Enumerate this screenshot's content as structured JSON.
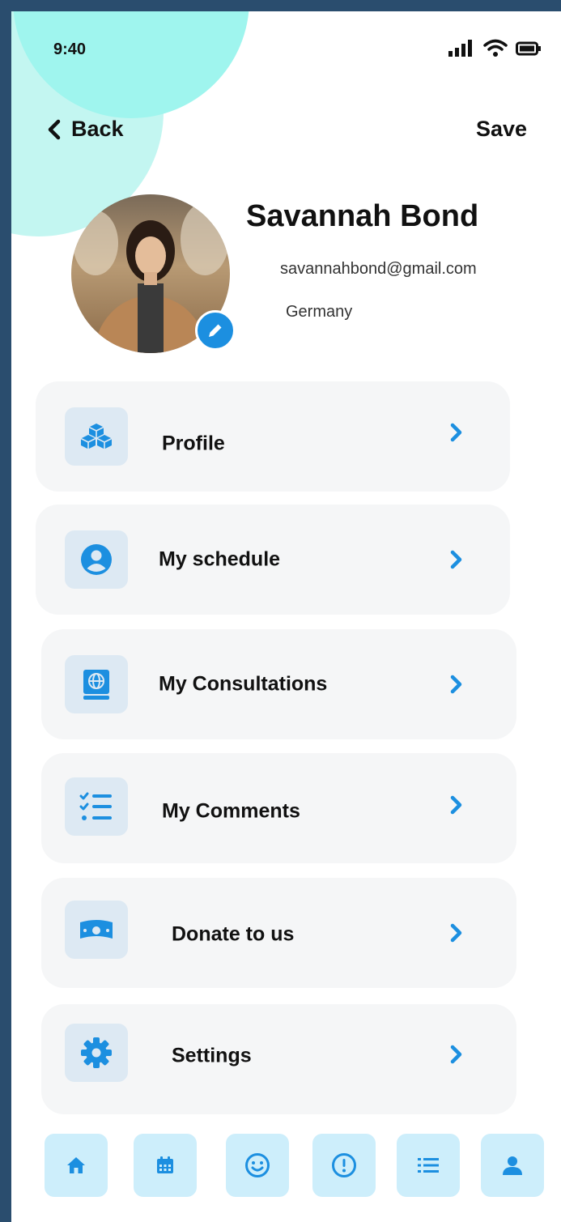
{
  "status": {
    "time": "9:40"
  },
  "header": {
    "back_label": "Back",
    "save_label": "Save"
  },
  "profile": {
    "name": "Savannah Bond",
    "email": "savannahbond@gmail.com",
    "country": "Germany"
  },
  "menu": [
    {
      "label": "Profile",
      "icon": "cubes-icon"
    },
    {
      "label": "My schedule",
      "icon": "user-circle-icon"
    },
    {
      "label": "My Consultations",
      "icon": "globe-book-icon"
    },
    {
      "label": "My Comments",
      "icon": "checklist-icon"
    },
    {
      "label": "Donate to us",
      "icon": "money-icon"
    },
    {
      "label": "Settings",
      "icon": "gear-icon"
    }
  ],
  "bottom_nav": [
    {
      "icon": "home-icon"
    },
    {
      "icon": "calendar-icon"
    },
    {
      "icon": "smile-icon"
    },
    {
      "icon": "alert-icon"
    },
    {
      "icon": "list-icon"
    },
    {
      "icon": "user-icon"
    }
  ],
  "colors": {
    "accent": "#1c8fe0",
    "blob": "#9ff5ee",
    "card": "#f5f6f7",
    "icon_tile": "#dde9f3",
    "nav_tile": "#cdeefb"
  }
}
